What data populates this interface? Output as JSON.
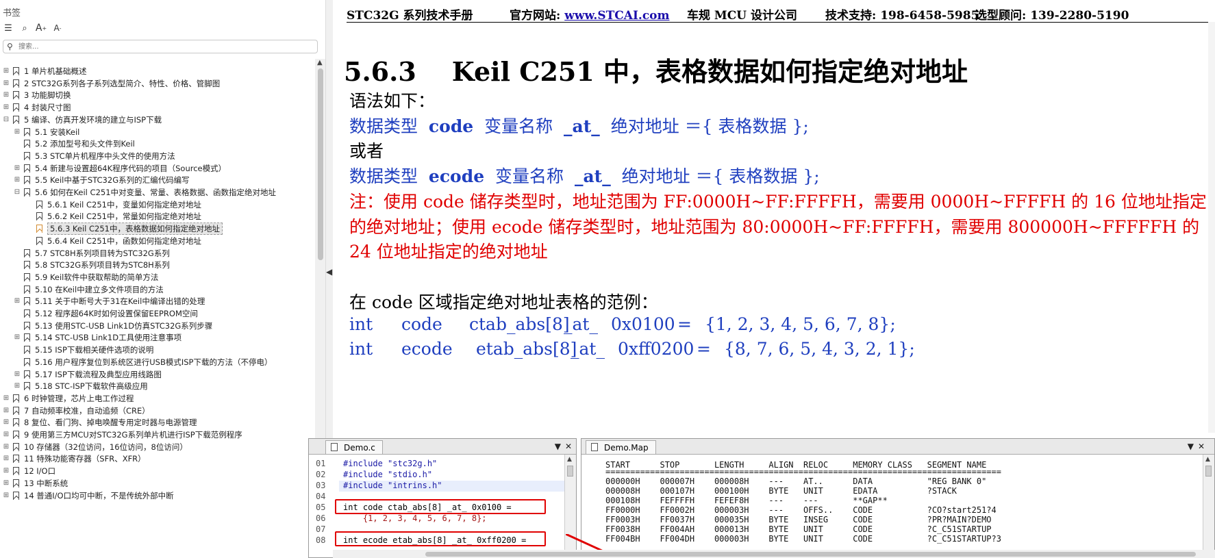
{
  "bookmarks": {
    "header": "书签",
    "toolbar": {
      "icons": [
        "list-view-icon",
        "bookmark-find-icon",
        "enlarge-text-icon",
        "shrink-text-icon"
      ],
      "enlarge_label": "A",
      "shrink_label": "A"
    },
    "search": {
      "placeholder": "搜索..."
    },
    "items": [
      {
        "label": "1 单片机基础概述",
        "level": 0,
        "expander": "+"
      },
      {
        "label": "2 STC32G系列各子系列选型简介、特性、价格、管脚图",
        "level": 0,
        "expander": "+"
      },
      {
        "label": "3 功能脚切换",
        "level": 0,
        "expander": "+"
      },
      {
        "label": "4 封装尺寸图",
        "level": 0,
        "expander": "+"
      },
      {
        "label": "5 编译、仿真开发环境的建立与ISP下载",
        "level": 0,
        "expander": "-"
      },
      {
        "label": "5.1 安装Keil",
        "level": 1,
        "expander": "+"
      },
      {
        "label": "5.2 添加型号和头文件到Keil",
        "level": 1,
        "expander": ""
      },
      {
        "label": "5.3 STC单片机程序中头文件的使用方法",
        "level": 1,
        "expander": ""
      },
      {
        "label": "5.4 新建与设置超64K程序代码的项目（Source模式）",
        "level": 1,
        "expander": "+"
      },
      {
        "label": "5.5 Keil中基于STC32G系列的汇编代码编写",
        "level": 1,
        "expander": "+"
      },
      {
        "label": "5.6 如何在Keil C251中对变量、常量、表格数据、函数指定绝对地址",
        "level": 1,
        "expander": "-"
      },
      {
        "label": "5.6.1 Keil C251中，变量如何指定绝对地址",
        "level": 2,
        "expander": ""
      },
      {
        "label": "5.6.2 Keil C251中，常量如何指定绝对地址",
        "level": 2,
        "expander": ""
      },
      {
        "label": "5.6.3 Keil C251中，表格数据如何指定绝对地址",
        "level": 2,
        "expander": "",
        "selected": true
      },
      {
        "label": "5.6.4 Keil C251中，函数如何指定绝对地址",
        "level": 2,
        "expander": ""
      },
      {
        "label": "5.7 STC8H系列项目转为STC32G系列",
        "level": 1,
        "expander": ""
      },
      {
        "label": "5.8 STC32G系列项目转为STC8H系列",
        "level": 1,
        "expander": ""
      },
      {
        "label": "5.9 Keil软件中获取帮助的简单方法",
        "level": 1,
        "expander": ""
      },
      {
        "label": "5.10 在Keil中建立多文件项目的方法",
        "level": 1,
        "expander": ""
      },
      {
        "label": "5.11 关于中断号大于31在Keil中编译出错的处理",
        "level": 1,
        "expander": "+"
      },
      {
        "label": "5.12 程序超64K时如何设置保留EEPROM空间",
        "level": 1,
        "expander": ""
      },
      {
        "label": "5.13 使用STC-USB Link1D仿真STC32G系列步骤",
        "level": 1,
        "expander": ""
      },
      {
        "label": "5.14 STC-USB Link1D工具使用注意事项",
        "level": 1,
        "expander": "+"
      },
      {
        "label": "5.15 ISP下载相关硬件选项的说明",
        "level": 1,
        "expander": ""
      },
      {
        "label": "5.16 用户程序复位到系统区进行USB模式ISP下载的方法（不停电）",
        "level": 1,
        "expander": ""
      },
      {
        "label": "5.17 ISP下载流程及典型应用线路图",
        "level": 1,
        "expander": "+"
      },
      {
        "label": "5.18 STC-ISP下载软件高级应用",
        "level": 1,
        "expander": "+"
      },
      {
        "label": "6 时钟管理，芯片上电工作过程",
        "level": 0,
        "expander": "+"
      },
      {
        "label": "7 自动频率校准，自动追频（CRE）",
        "level": 0,
        "expander": "+"
      },
      {
        "label": "8 复位、看门狗、掉电唤醒专用定时器与电源管理",
        "level": 0,
        "expander": "+"
      },
      {
        "label": "9 使用第三方MCU对STC32G系列单片机进行ISP下载范例程序",
        "level": 0,
        "expander": "+"
      },
      {
        "label": "10 存储器（32位访问，16位访问，8位访问）",
        "level": 0,
        "expander": "+"
      },
      {
        "label": "11 特殊功能寄存器（SFR、XFR）",
        "level": 0,
        "expander": "+"
      },
      {
        "label": "12 I/O口",
        "level": 0,
        "expander": "+"
      },
      {
        "label": "13 中断系统",
        "level": 0,
        "expander": "+"
      },
      {
        "label": "14 普通I/O口均可中断，不是传统外部中断",
        "level": 0,
        "expander": "+"
      }
    ]
  },
  "document": {
    "header": {
      "manual": "STC32G 系列技术手册",
      "site_label": "官方网站: ",
      "site_link": "www.STCAI.com",
      "company": "车规 MCU 设计公司",
      "support": "技术支持: 198-6458-5985",
      "advisor": "选型顾问: 139-2280-5190"
    },
    "section_number": "5.6.3",
    "section_title": "Keil C251 中，表格数据如何指定绝对地址",
    "syntax_intro": "语法如下：",
    "syntax1": {
      "type": "数据类型",
      "kw": "code",
      "var": "变量名称",
      "at": "_at_",
      "rest": "绝对地址 ＝{ 表格数据 };"
    },
    "or": "或者",
    "syntax2": {
      "type": "数据类型",
      "kw": "ecode",
      "var": "变量名称",
      "at": "_at_",
      "rest": "绝对地址 ＝{ 表格数据 };"
    },
    "note": [
      "注：使用 code 储存类型时，地址范围为 FF:0000H~FF:FFFFH，需要用 0000H~FFFFH 的 16 位地址指定",
      "的绝对地址；使用 ecode 储存类型时，地址范围为 80:0000H~FF:FFFFH，需要用 800000H~FFFFFH 的",
      "24 位地址指定的绝对地址"
    ],
    "example_intro": "在 code 区域指定绝对地址表格的范例：",
    "example1": [
      "int",
      "code",
      "ctab_abs[8]",
      "_at_",
      "0x0100",
      "=",
      "{1, 2, 3, 4, 5, 6, 7, 8};"
    ],
    "example2": [
      "int",
      "ecode",
      "etab_abs[8]",
      "_at_",
      "0xff0200",
      "=",
      "{8, 7, 6, 5, 4, 3, 2, 1};"
    ]
  },
  "editor_demo_c": {
    "tab": "Demo.c",
    "lines": [
      {
        "n": "01",
        "t": "#include \"stc32g.h\""
      },
      {
        "n": "02",
        "t": "#include \"stdio.h\""
      },
      {
        "n": "03",
        "t": "#include \"intrins.h\""
      },
      {
        "n": "04",
        "t": ""
      },
      {
        "n": "05",
        "t": "int code ctab_abs[8] _at_ 0x0100 ="
      },
      {
        "n": "06",
        "t": "    {1, 2, 3, 4, 5, 6, 7, 8};"
      },
      {
        "n": "07",
        "t": ""
      },
      {
        "n": "08",
        "t": "int ecode etab_abs[8] _at_ 0xff0200 ="
      }
    ]
  },
  "editor_demo_map": {
    "tab": "Demo.Map",
    "header": "START      STOP       LENGTH     ALIGN  RELOC     MEMORY CLASS   SEGMENT NAME",
    "separator": "================================================================================",
    "rows": [
      "000000H    000007H    000008H    ---    AT..      DATA           \"REG BANK 0\"",
      "000008H    000107H    000100H    BYTE   UNIT      EDATA          ?STACK",
      "000108H    FEFFFFH    FEFEF8H    ---    ---       **GAP**",
      "FF0000H    FF0002H    000003H    ---    OFFS..    CODE           ?CO?start251?4",
      "FF0003H    FF0037H    000035H    BYTE   INSEG     CODE           ?PR?MAIN?DEMO",
      "FF0038H    FF004AH    000013H    BYTE   UNIT      CODE           ?C_C51STARTUP",
      "FF004BH    FF004DH    000003H    BYTE   UNIT      CODE           ?C_C51STARTUP?3"
    ]
  }
}
